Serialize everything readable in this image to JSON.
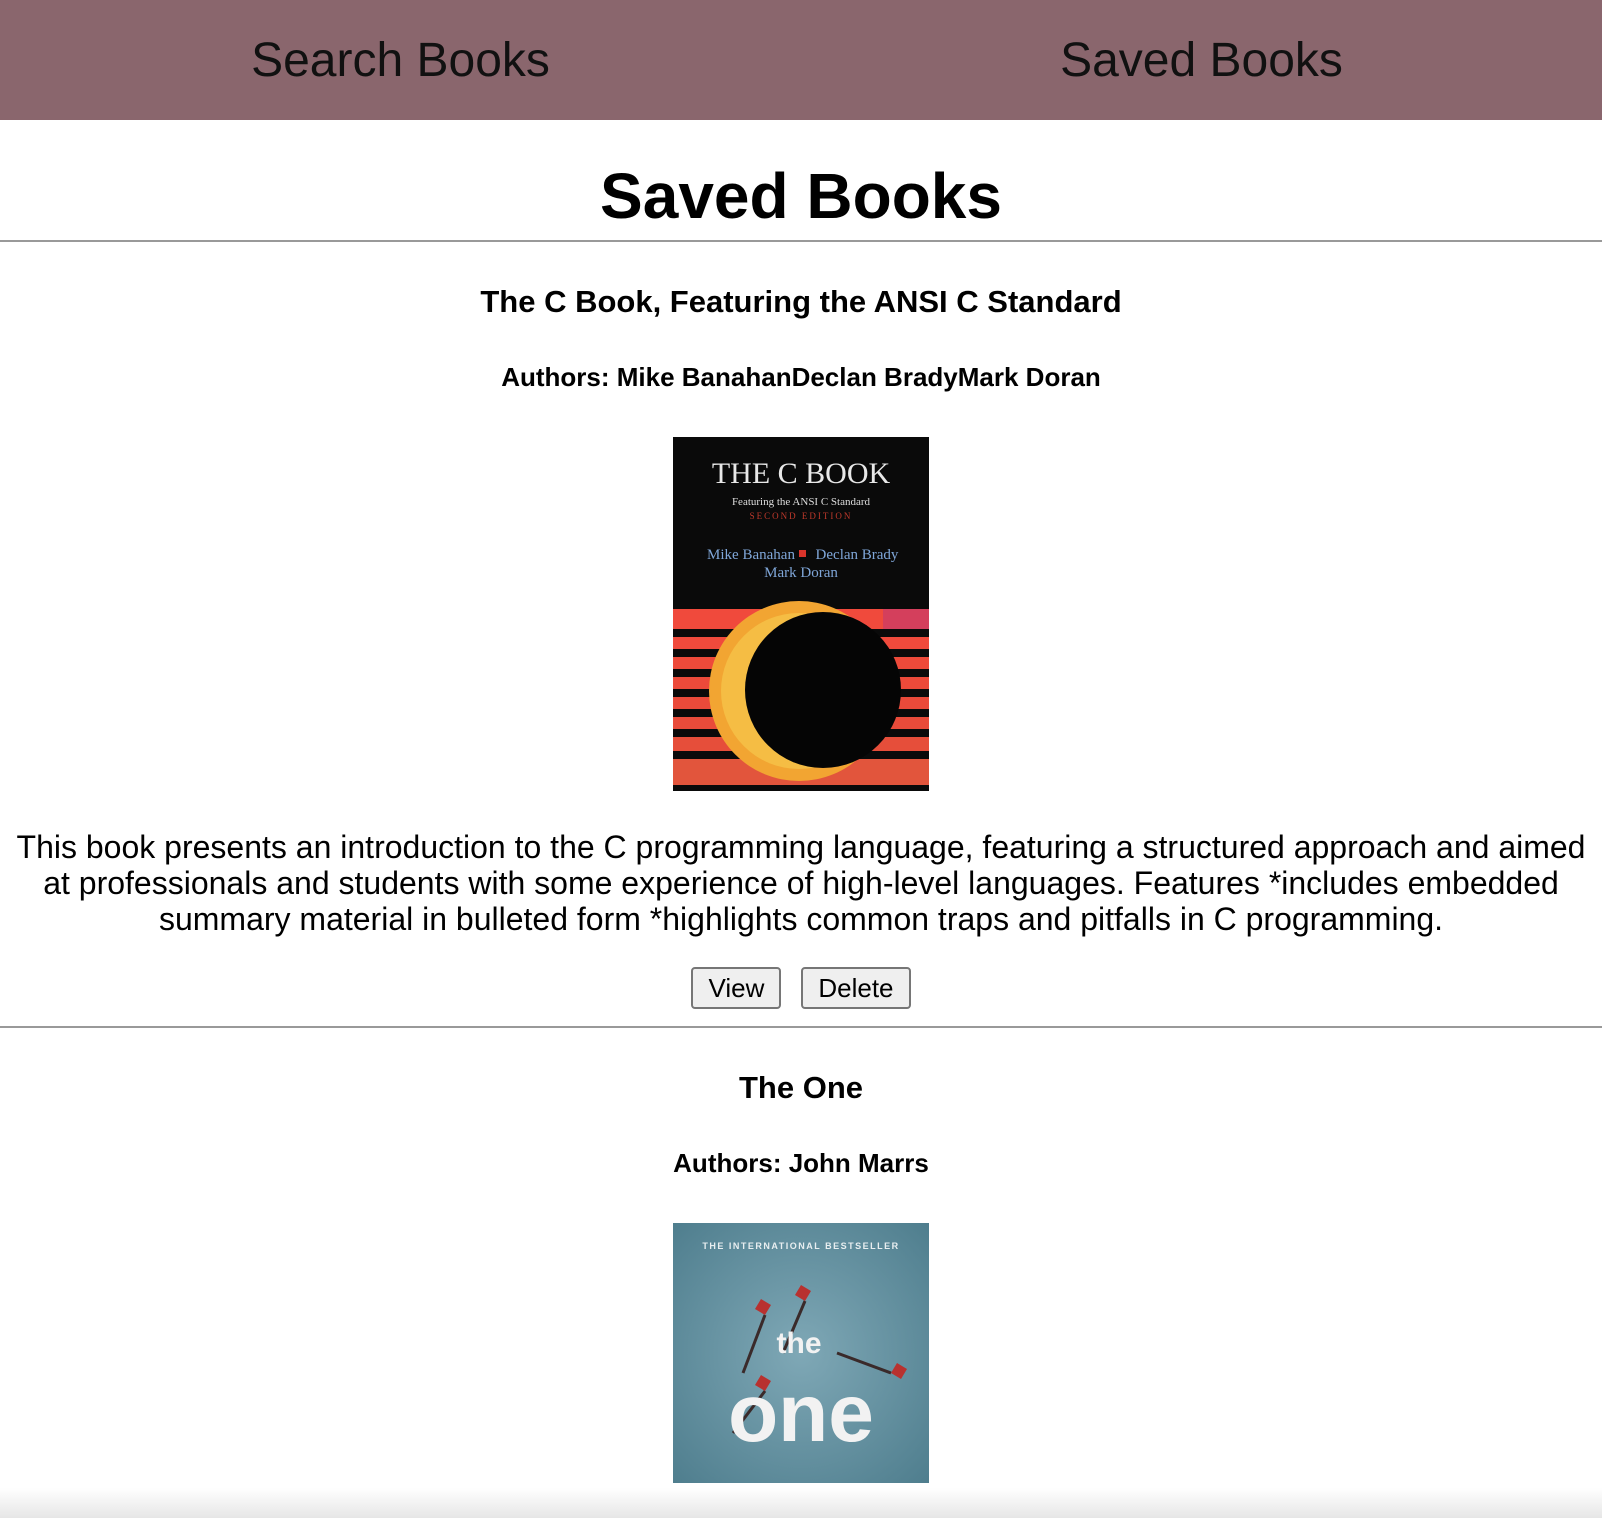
{
  "nav": {
    "search_label": "Search Books",
    "saved_label": "Saved Books",
    "background": "#8a666d"
  },
  "page": {
    "title": "Saved Books"
  },
  "books": [
    {
      "title": "The C Book, Featuring the ANSI C Standard",
      "authors": "Authors: Mike BanahanDeclan BradyMark Doran",
      "cover": {
        "heading": "THE C BOOK",
        "subtitle": "Featuring the ANSI C Standard",
        "edition": "SECOND EDITION",
        "author_line1": "Mike Banahan",
        "author_line1b": "Declan Brady",
        "author_line2": "Mark Doran"
      },
      "description": "This book presents an introduction to the C programming language, featuring a structured approach and aimed at professionals and students with some experience of high-level languages. Features *includes embedded summary material in bulleted form *highlights common traps and pitfalls in C programming.",
      "view_label": "View",
      "delete_label": "Delete"
    },
    {
      "title": "The One",
      "authors": "Authors: John Marrs",
      "cover": {
        "tagline": "THE INTERNATIONAL BESTSELLER",
        "word1": "the",
        "word2": "one"
      }
    }
  ]
}
